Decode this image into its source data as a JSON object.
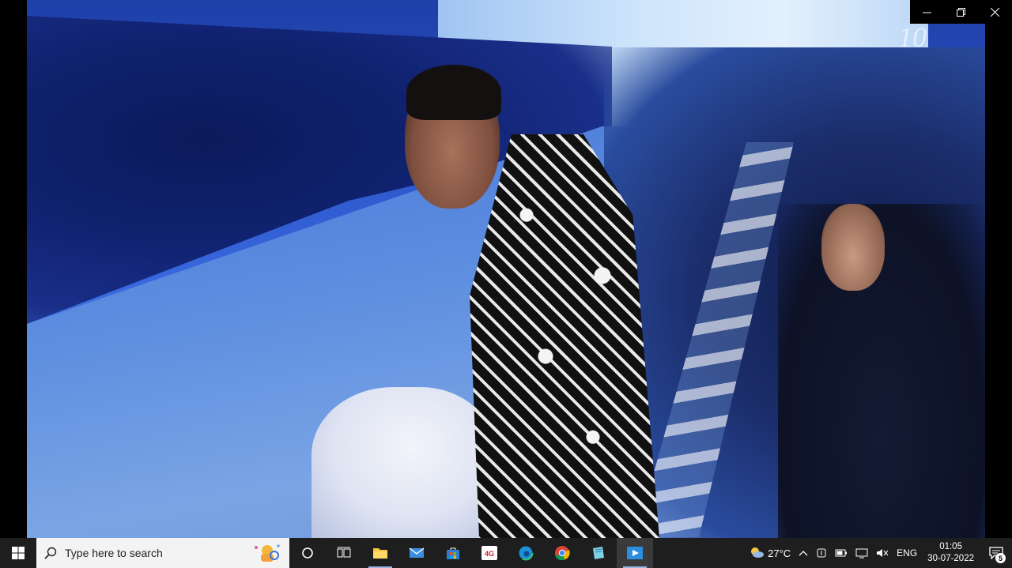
{
  "window": {
    "controls": {
      "minimize_icon": "minimize-icon",
      "maximize_icon": "restore-icon",
      "close_icon": "close-icon"
    }
  },
  "photo": {
    "sign_text": "10"
  },
  "taskbar": {
    "search_placeholder": "Type here to search",
    "pinned_apps": [
      "Task View",
      "File Explorer",
      "Mail",
      "Microsoft Store",
      "4G App",
      "Microsoft Edge",
      "Google Chrome",
      "Notepad",
      "Media Player"
    ],
    "weather": {
      "temp": "27°C"
    },
    "language": "ENG",
    "time": "01:05",
    "date": "30-07-2022",
    "notification_count": "5",
    "colors": {
      "taskbar_bg": "#1e1e1e",
      "search_bg": "#f3f3f3",
      "accent": "#9ab6e6"
    }
  }
}
